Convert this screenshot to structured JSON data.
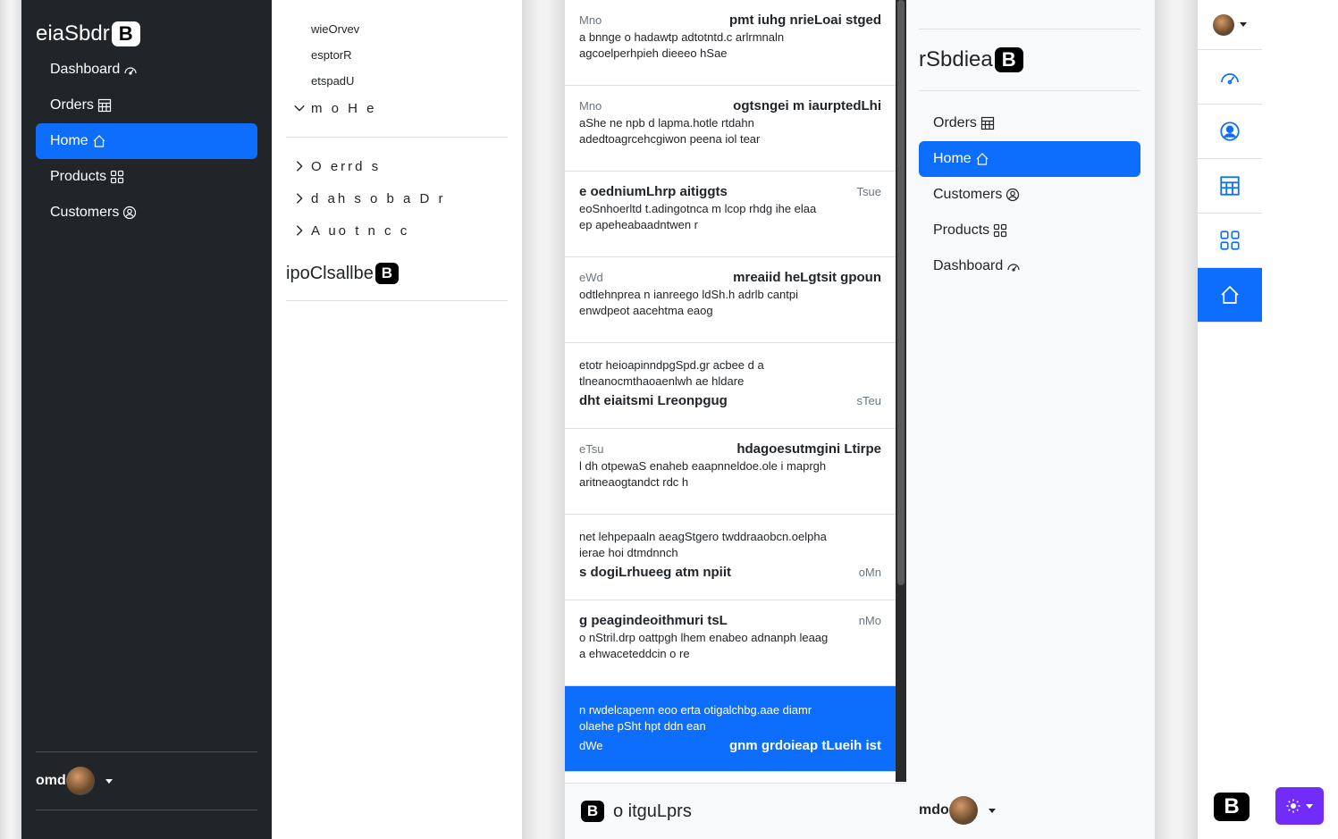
{
  "panel1": {
    "brand": "eiaSbdr",
    "logo_letter": "B",
    "nav": [
      {
        "label": "Dashboard",
        "icon": "speedometer-icon",
        "active": false
      },
      {
        "label": "Orders",
        "icon": "table-icon",
        "active": false
      },
      {
        "label": "Home",
        "icon": "house-icon",
        "active": true
      },
      {
        "label": "Products",
        "icon": "grid-icon",
        "active": false
      },
      {
        "label": "Customers",
        "icon": "person-circle-icon",
        "active": false
      }
    ],
    "user": "omd"
  },
  "panel2": {
    "sub_items": [
      "wieOrvev",
      "esptorR",
      "etspadU"
    ],
    "expanded": "m o H e",
    "collapsed": [
      "O errd s",
      "d ah s o b a D r",
      "A uo t n c c"
    ],
    "brand": "ipoClsallbe",
    "logo_letter": "B"
  },
  "panel3": {
    "items": [
      {
        "meta": "Mno",
        "title": "pmt iuhg nrieLoai stged",
        "text": "a bnnge o hadawtp adtotntd.c arlrmnaln agcoelperhpieh dieeeo hSae",
        "layout": "meta-left"
      },
      {
        "meta": "Mno",
        "title": "ogtsngei m iaurptedLhi",
        "text": "aShe ne npb d lapma.hotle rtdahn adedtoagrcehcgiwon peena iol tear",
        "layout": "meta-left"
      },
      {
        "meta": "Tsue",
        "title": "e oedniumLhrp aitiggts",
        "text": "eoSnhoerltd t.adingotnca m lcop rhdg ihe elaa ep apeheabaadntwen r",
        "layout": "title-left"
      },
      {
        "meta": "eWd",
        "title": "mreaiid heLgtsit gpoun",
        "text": "odtlehnprea n ianreego ldSh.h adrlb cantpi enwdpeot aacehtma eaog",
        "layout": "meta-left"
      },
      {
        "meta": "sTeu",
        "title": "dht eiaitsmi Lreonpgug",
        "text": "etotr heioapinndpgSpd.gr acbee d a tlneanocmthaoaenlwh ae hldare",
        "layout": "text-first"
      },
      {
        "meta": "eTsu",
        "title": "hdagoesutmgini Ltirpe",
        "text": "l dh otpewaS enaheb eaapnneldoe.ole i maprgh aritneaogtandct rdc h",
        "layout": "meta-left"
      },
      {
        "meta": "oMn",
        "title": "s dogiLrhueeg atm npiit",
        "text": "net lehpepaaln aeagStgero twddraaobcn.oelpha ierae hoi dtmdnnch",
        "layout": "text-first"
      },
      {
        "meta": "nMo",
        "title": "g peagindeoithmuri tsL",
        "text": "o nStril.drp oattpgh lhem enabeo adnanph leaag a ehwaceteddcin o re",
        "layout": "title-left"
      },
      {
        "meta": "dWe",
        "title": "gnm grdoieap tLueih ist",
        "text": "n rwdelcapenn eoo erta otigalchbg.aae diamr olaehe pSht hpt ddn ean",
        "layout": "text-first-active"
      }
    ],
    "footer": "o itguLprs",
    "logo_letter": "B"
  },
  "panel4": {
    "brand": "rSbdiea",
    "logo_letter": "B",
    "nav": [
      {
        "label": "Orders",
        "icon": "table-icon",
        "active": false
      },
      {
        "label": "Home",
        "icon": "house-icon",
        "active": true
      },
      {
        "label": "Customers",
        "icon": "person-circle-icon",
        "active": false
      },
      {
        "label": "Products",
        "icon": "grid-icon",
        "active": false
      },
      {
        "label": "Dashboard",
        "icon": "speedometer-icon",
        "active": false
      }
    ],
    "user": "mdo"
  },
  "panel5": {
    "icons": [
      "speedometer-icon",
      "person-circle-icon",
      "table-icon",
      "grid-icon",
      "house-icon"
    ],
    "active_index": 4,
    "logo_letter": "B"
  },
  "colors": {
    "primary": "#0d6efd",
    "dark": "#212529",
    "theme_button": "#712cf9"
  }
}
